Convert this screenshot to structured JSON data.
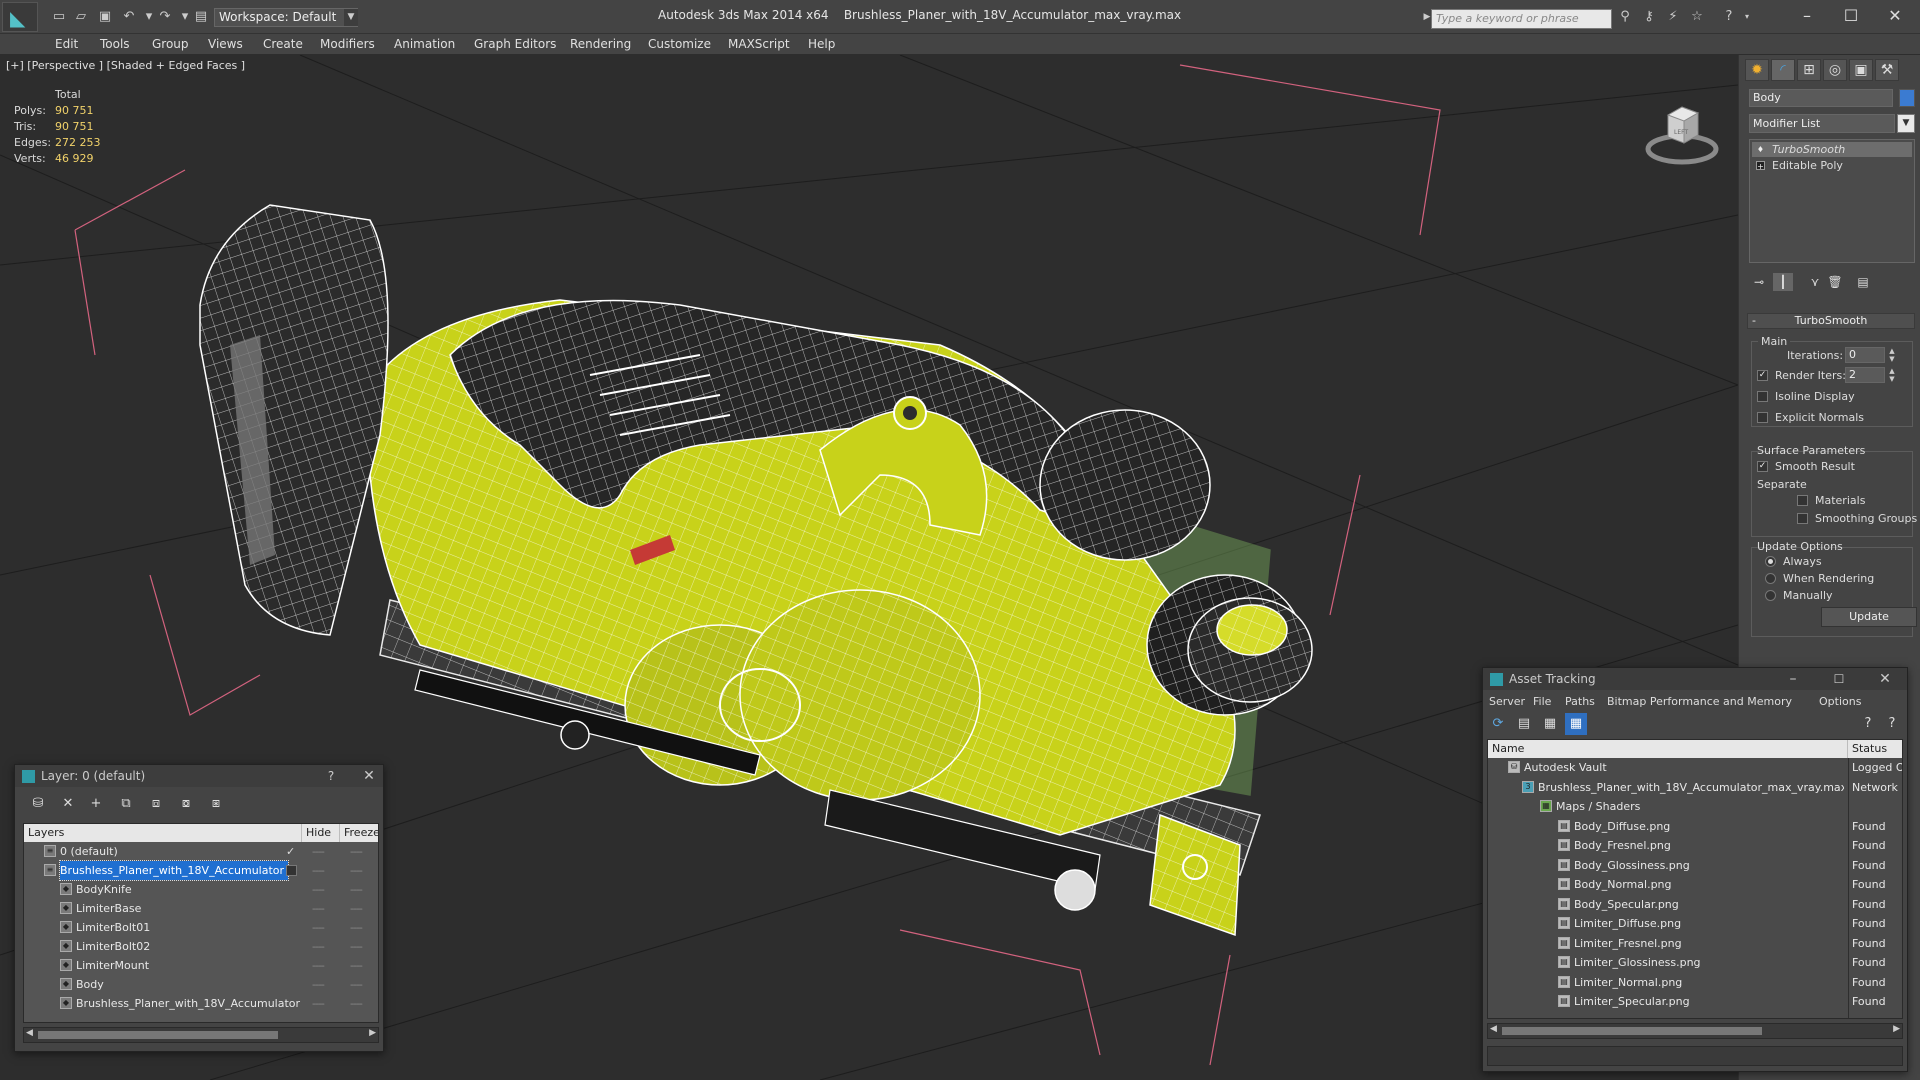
{
  "titlebar": {
    "workspace": "Workspace: Default",
    "app_name": "Autodesk 3ds Max  2014 x64",
    "file_name": "Brushless_Planer_with_18V_Accumulator_max_vray.max",
    "search_placeholder": "Type a keyword or phrase"
  },
  "menu": [
    "Edit",
    "Tools",
    "Group",
    "Views",
    "Create",
    "Modifiers",
    "Animation",
    "Graph Editors",
    "Rendering",
    "Customize",
    "MAXScript",
    "Help"
  ],
  "viewport": {
    "label": "[+] [Perspective ] [Shaded + Edged Faces ]",
    "stats": {
      "total_label": "Total",
      "polys_label": "Polys:",
      "polys": "90 751",
      "tris_label": "Tris:",
      "tris": "90 751",
      "edges_label": "Edges:",
      "edges": "272 253",
      "verts_label": "Verts:",
      "verts": "46 929"
    },
    "viewcube_label": "LEFT"
  },
  "command_panel": {
    "object_name": "Body",
    "modifier_list": "Modifier List",
    "stack": [
      "TurboSmooth",
      "Editable Poly"
    ],
    "rollout_title": "TurboSmooth",
    "main_label": "Main",
    "iterations_label": "Iterations:",
    "iterations": "0",
    "render_iters_label": "Render Iters:",
    "render_iters": "2",
    "isoline_label": "Isoline Display",
    "explicit_label": "Explicit Normals",
    "surface_label": "Surface Parameters",
    "smooth_label": "Smooth Result",
    "separate_label": "Separate",
    "materials_label": "Materials",
    "smoothing_label": "Smoothing Groups",
    "update_options_label": "Update Options",
    "always_label": "Always",
    "when_rendering_label": "When Rendering",
    "manually_label": "Manually",
    "update_button": "Update"
  },
  "layer_window": {
    "title": "Layer: 0 (default)",
    "help": "?",
    "col_layers": "Layers",
    "col_hide": "Hide",
    "col_freeze": "Freeze",
    "rows": [
      {
        "name": "0 (default)",
        "indent": 0
      },
      {
        "name": "Brushless_Planer_with_18V_Accumulator",
        "indent": 0
      },
      {
        "name": "BodyKnife",
        "indent": 1
      },
      {
        "name": "LimiterBase",
        "indent": 1
      },
      {
        "name": "LimiterBolt01",
        "indent": 1
      },
      {
        "name": "LimiterBolt02",
        "indent": 1
      },
      {
        "name": "LimiterMount",
        "indent": 1
      },
      {
        "name": "Body",
        "indent": 1
      },
      {
        "name": "Brushless_Planer_with_18V_Accumulator",
        "indent": 1
      }
    ],
    "dash": "----"
  },
  "asset_window": {
    "title": "Asset Tracking",
    "menu": [
      "Server",
      "File",
      "Paths",
      "Bitmap Performance and Memory",
      "Options"
    ],
    "col_name": "Name",
    "col_status": "Status",
    "rows": [
      {
        "name": "Autodesk Vault",
        "status": "Logged Ou",
        "level": 0
      },
      {
        "name": "Brushless_Planer_with_18V_Accumulator_max_vray.max",
        "status": "Network P",
        "level": 1
      },
      {
        "name": "Maps / Shaders",
        "status": "",
        "level": 2
      },
      {
        "name": "Body_Diffuse.png",
        "status": "Found",
        "level": 3
      },
      {
        "name": "Body_Fresnel.png",
        "status": "Found",
        "level": 3
      },
      {
        "name": "Body_Glossiness.png",
        "status": "Found",
        "level": 3
      },
      {
        "name": "Body_Normal.png",
        "status": "Found",
        "level": 3
      },
      {
        "name": "Body_Specular.png",
        "status": "Found",
        "level": 3
      },
      {
        "name": "Limiter_Diffuse.png",
        "status": "Found",
        "level": 3
      },
      {
        "name": "Limiter_Fresnel.png",
        "status": "Found",
        "level": 3
      },
      {
        "name": "Limiter_Glossiness.png",
        "status": "Found",
        "level": 3
      },
      {
        "name": "Limiter_Normal.png",
        "status": "Found",
        "level": 3
      },
      {
        "name": "Limiter_Specular.png",
        "status": "Found",
        "level": 3
      }
    ]
  },
  "colors": {
    "model_yellow": "#c8d21a",
    "selection_blue": "#1f6fd1",
    "stat_value": "#f1d26a"
  }
}
